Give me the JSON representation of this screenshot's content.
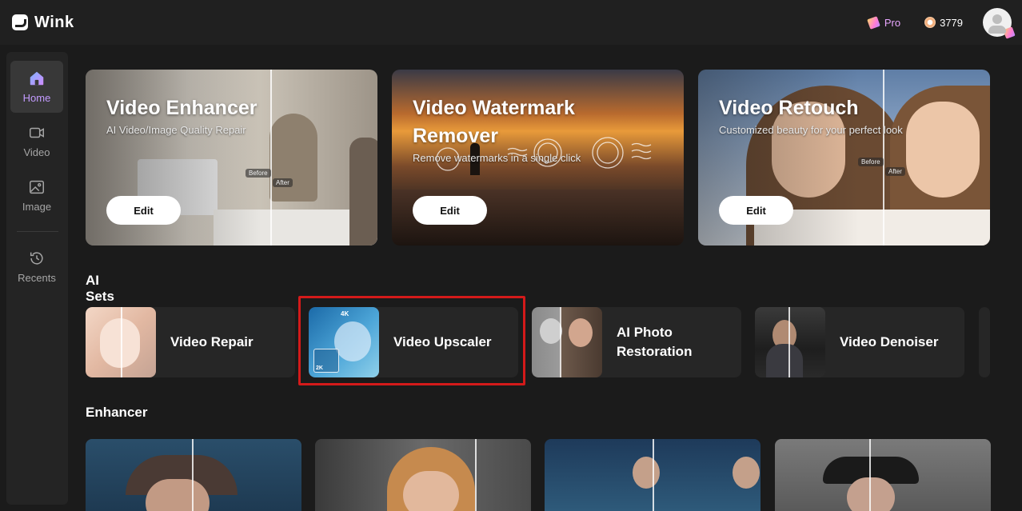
{
  "app": {
    "name": "Wink"
  },
  "header": {
    "pro_label": "Pro",
    "coins": "3779"
  },
  "sidebar": {
    "items": [
      {
        "label": "Home",
        "icon": "home-icon",
        "active": true
      },
      {
        "label": "Video",
        "icon": "video-icon",
        "active": false
      },
      {
        "label": "Image",
        "icon": "image-icon",
        "active": false
      },
      {
        "label": "Recents",
        "icon": "history-icon",
        "active": false
      }
    ]
  },
  "hero_cards": [
    {
      "title": "Video Enhancer",
      "subtitle": "AI Video/Image Quality Repair",
      "button": "Edit",
      "tag_before": "Before",
      "tag_after": "After"
    },
    {
      "title": "Video Watermark Remover",
      "subtitle": "Remove watermarks in a single click",
      "button": "Edit"
    },
    {
      "title": "Video Retouch",
      "subtitle": "Customized beauty for your perfect look",
      "button": "Edit",
      "tag_before": "Before",
      "tag_after": "After"
    }
  ],
  "sections": {
    "ai_sets": "AI Sets",
    "enhancer": "Enhancer"
  },
  "ai_sets": [
    {
      "label": "Video Repair"
    },
    {
      "label": "Video Upscaler",
      "badge_top": "4K",
      "badge_bottom": "2K"
    },
    {
      "label": "AI Photo Restoration"
    },
    {
      "label": "Video Denoiser"
    }
  ],
  "colors": {
    "accent": "#c39bff",
    "highlight": "#d41a1a",
    "pro": "#e8a6ff"
  }
}
